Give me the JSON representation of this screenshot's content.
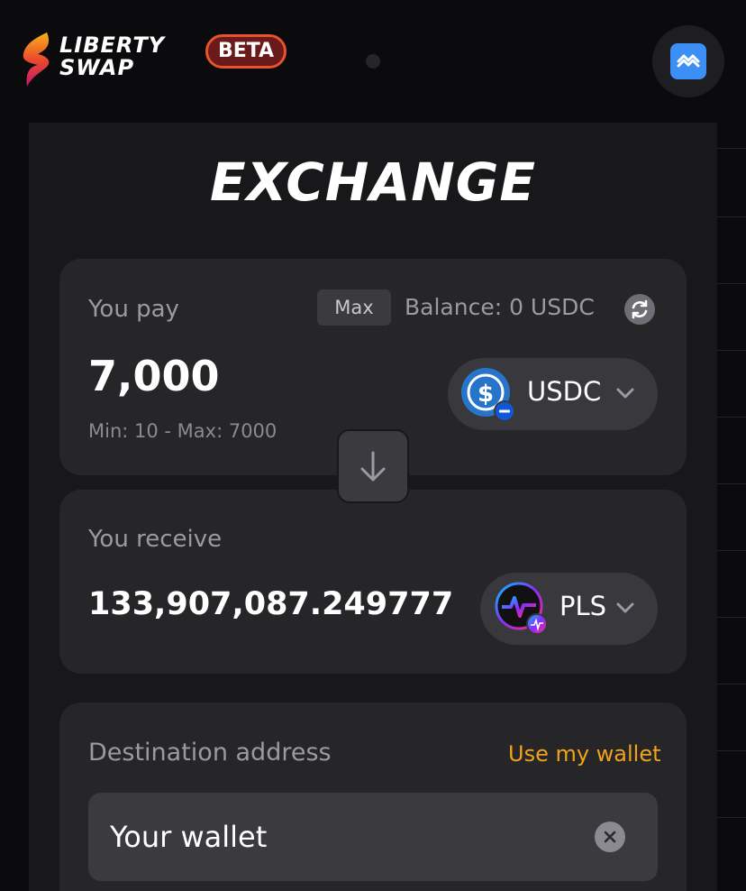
{
  "header": {
    "logo_line1": "LIBERTY",
    "logo_line2": "SWAP",
    "beta_label": "BETA",
    "wallet_icon": "wallet-icon"
  },
  "page": {
    "title": "EXCHANGE"
  },
  "pay": {
    "label": "You pay",
    "max_label": "Max",
    "balance": "Balance: 0 USDC",
    "amount": "7,000",
    "limits": "Min: 10 - Max: 7000",
    "token": "USDC",
    "token_color": "#2775ca"
  },
  "receive": {
    "label": "You receive",
    "amount": "133,907,087.249777",
    "token": "PLS"
  },
  "destination": {
    "label": "Destination address",
    "use_wallet": "Use my wallet",
    "placeholder": "Your wallet"
  },
  "colors": {
    "accent_orange": "#f0a21b",
    "beta_border": "#e6532e",
    "wallet_blue": "#3b8ff5"
  }
}
